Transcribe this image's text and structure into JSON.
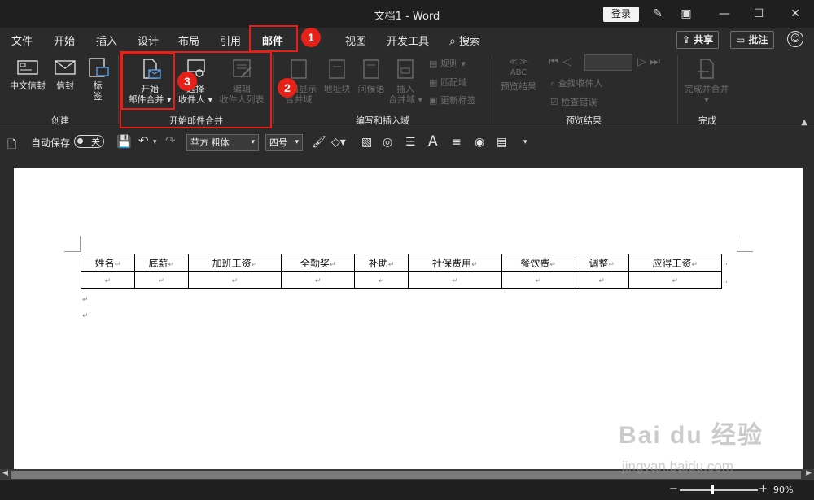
{
  "titlebar": {
    "title": "文档1  -  Word",
    "login": "登录"
  },
  "tabs": [
    "文件",
    "开始",
    "插入",
    "设计",
    "布局",
    "引用",
    "邮件",
    "视图",
    "开发工具",
    "搜索"
  ],
  "share": "共享",
  "comments": "批注",
  "ribbon": {
    "create": {
      "envelope_cn": "中文信封",
      "envelope": "信封",
      "label_line1": "标",
      "label_line2": "签",
      "group": "创建"
    },
    "start_merge": {
      "start_line1": "开始",
      "start_line2": "邮件合并",
      "select_line1": "选择",
      "select_line2": "收件人",
      "edit_line1": "编辑",
      "edit_line2": "收件人列表",
      "group": "开始邮件合并"
    },
    "write_insert": {
      "highlight_line1": "突出显示",
      "highlight_line2": "合并域",
      "address_block": "地址块",
      "greeting": "问候语",
      "insert_line1": "插入",
      "insert_line2": "合并域",
      "rules": "规则",
      "match_fields": "匹配域",
      "update_labels": "更新标签",
      "group": "编写和插入域"
    },
    "preview": {
      "preview_results": "预览结果",
      "abc": "ABC",
      "find_recipient": "查找收件人",
      "check_errors": "检查错误",
      "group": "预览结果"
    },
    "finish": {
      "finish_merge": "完成并合并",
      "group": "完成"
    }
  },
  "qat": {
    "autosave": "自动保存",
    "toggle_state": "关",
    "font": "苹方 粗体",
    "size": "四号"
  },
  "table": {
    "headers": [
      "姓名",
      "底薪",
      "加班工资",
      "全勤奖",
      "补助",
      "社保费用",
      "餐饮费",
      "调整",
      "应得工资"
    ]
  },
  "status": {
    "zoom": "90%"
  },
  "annotations": {
    "b1": "1",
    "b2": "2",
    "b3": "3"
  },
  "watermark": {
    "brand": "Bai du 经验",
    "url": "jingyan.baidu.com"
  },
  "colors": {
    "accent_red": "#e62117",
    "ribbon_bg": "#2b2b2b",
    "titlebar_bg": "#1f1f1f"
  }
}
